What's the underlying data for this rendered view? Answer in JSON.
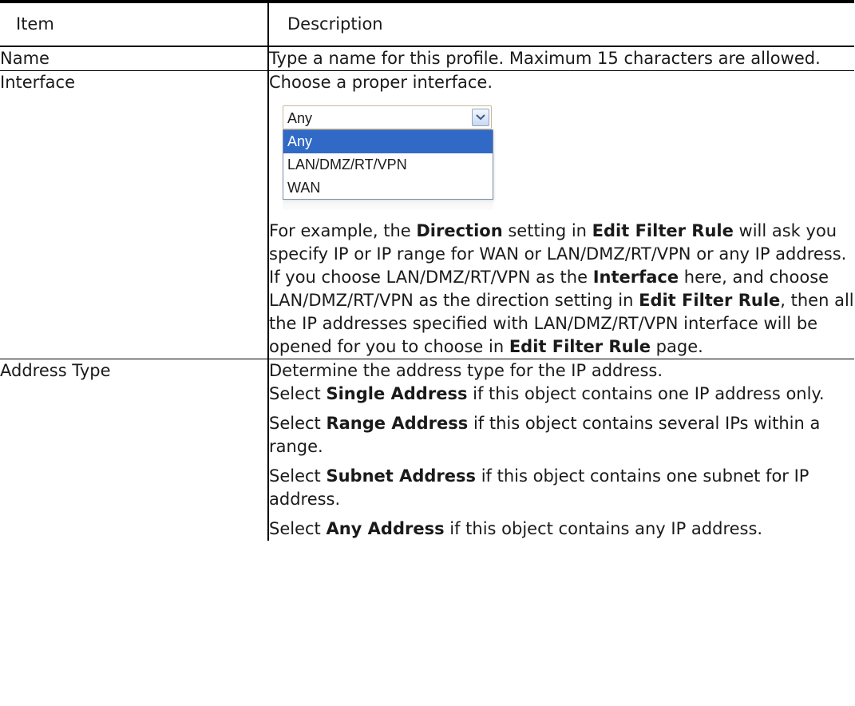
{
  "table": {
    "header": {
      "item": "Item",
      "description": "Description"
    },
    "name_row": {
      "item": "Name",
      "desc": "Type a name for this profile. Maximum 15 characters are allowed."
    },
    "interface_row": {
      "item": "Interface",
      "intro": "Choose a proper interface.",
      "dropdown": {
        "selected": "Any",
        "options": [
          "Any",
          "LAN/DMZ/RT/VPN",
          "WAN"
        ]
      },
      "p": [
        "For example, the ",
        "Direction",
        " setting in ",
        "Edit Filter Rule",
        " will ask you specify IP or IP range for WAN or LAN/DMZ/RT/VPN or any IP address. If you choose LAN/DMZ/RT/VPN as the ",
        "Interface",
        " here, and choose LAN/DMZ/RT/VPN as the direction setting in ",
        "Edit Filter Rule",
        ", then all the IP addresses specified with LAN/DMZ/RT/VPN interface will be opened for you to choose in ",
        "Edit Filter Rule",
        " page."
      ]
    },
    "address_row": {
      "item": "Address Type",
      "intro": "Determine the address type for the IP address.",
      "single": [
        "Select ",
        "Single Address",
        " if this object contains one IP address only."
      ],
      "range": [
        "Select ",
        "Range Address",
        " if this object contains several IPs within a range."
      ],
      "subnet": [
        "Select ",
        "Subnet Address",
        " if this object contains one subnet for IP address."
      ],
      "any": [
        "Select ",
        "Any Address",
        " if this object contains any IP address."
      ]
    }
  }
}
